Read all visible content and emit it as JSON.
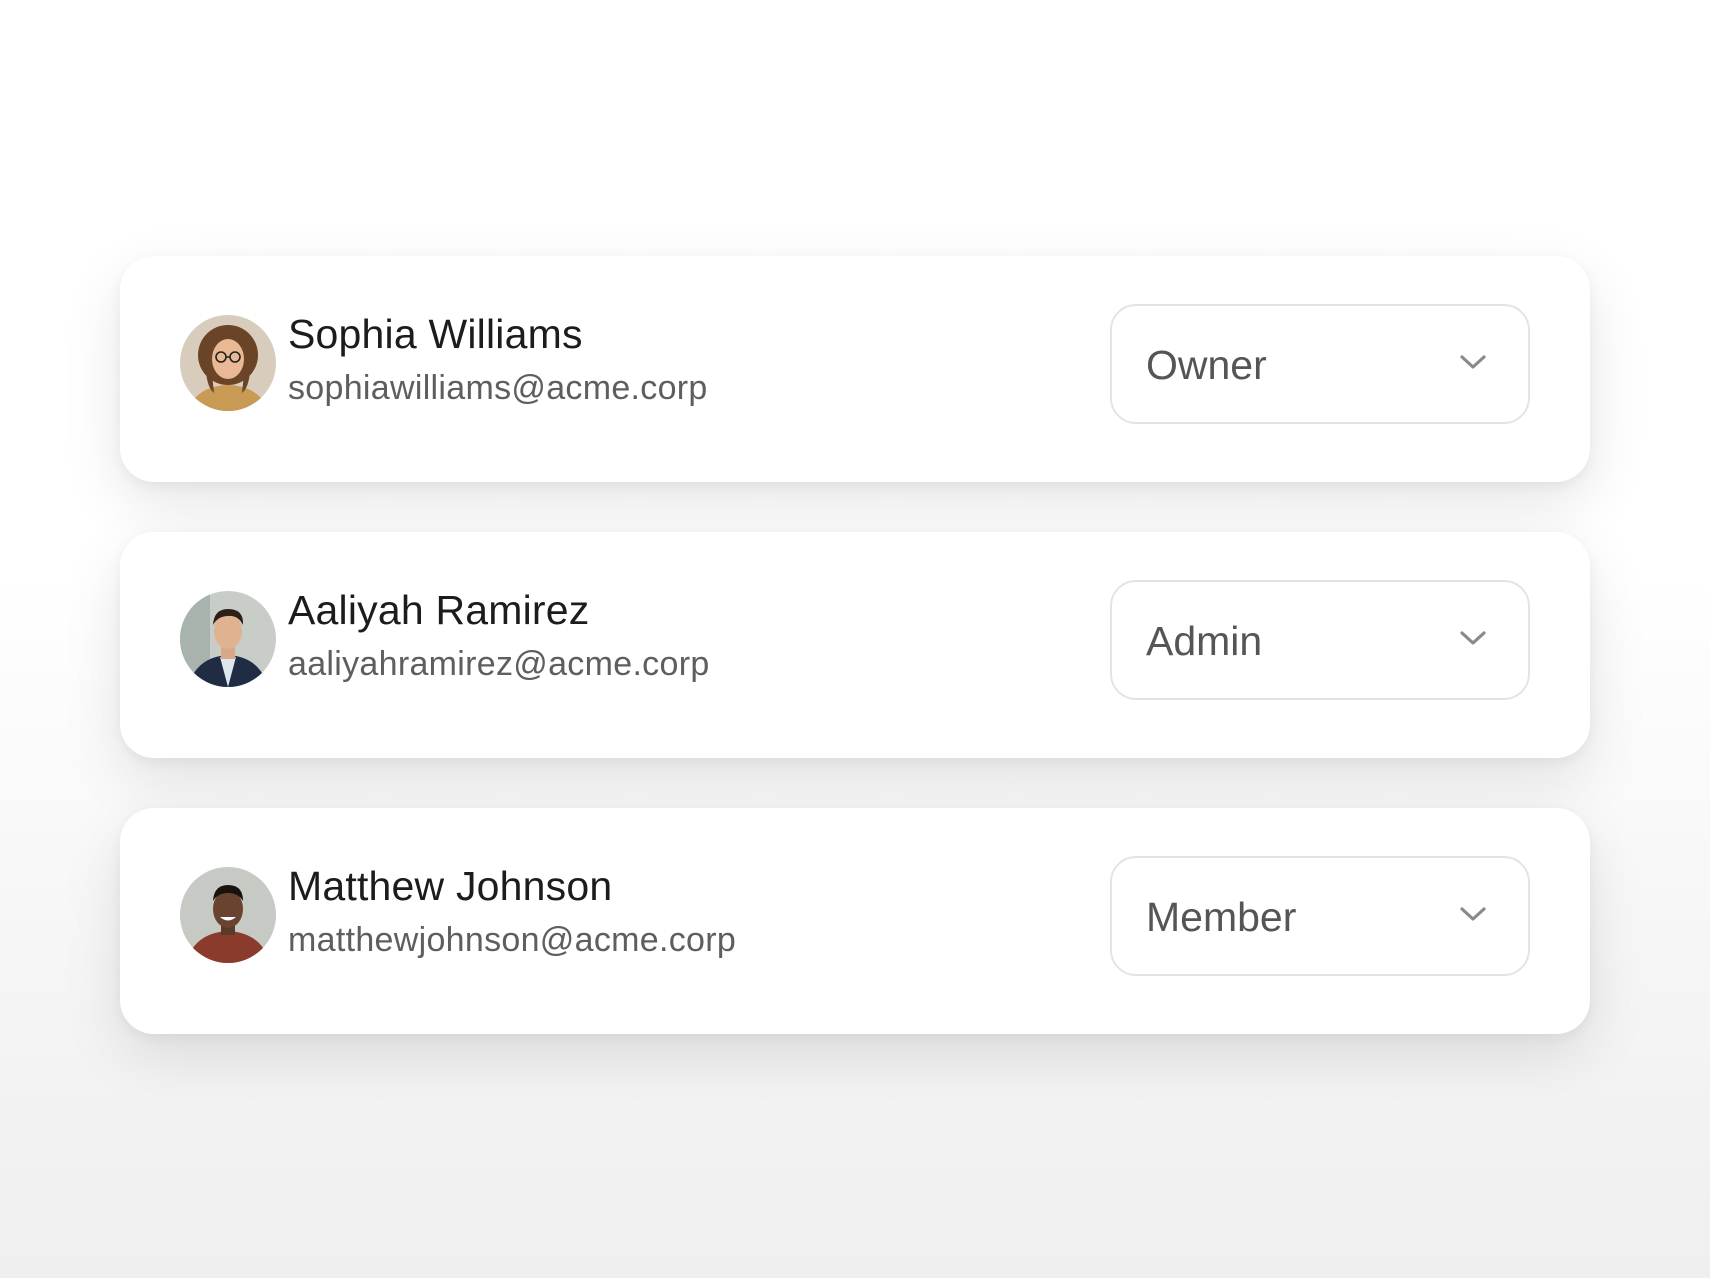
{
  "members": [
    {
      "name": "Sophia Williams",
      "email": "sophiawilliams@acme.corp",
      "role": "Owner",
      "avatar_icon": "avatar-photo"
    },
    {
      "name": "Aaliyah Ramirez",
      "email": "aaliyahramirez@acme.corp",
      "role": "Admin",
      "avatar_icon": "avatar-photo"
    },
    {
      "name": "Matthew Johnson",
      "email": "matthewjohnson@acme.corp",
      "role": "Member",
      "avatar_icon": "avatar-photo"
    }
  ],
  "dropdown_icon": "chevron-down-icon",
  "colors": {
    "card_background": "#ffffff",
    "name_text": "#1c1c1c",
    "email_text": "#5e5e5e",
    "select_border": "#e4e4e4",
    "select_text": "#555555",
    "chevron": "#8a8a8a"
  }
}
